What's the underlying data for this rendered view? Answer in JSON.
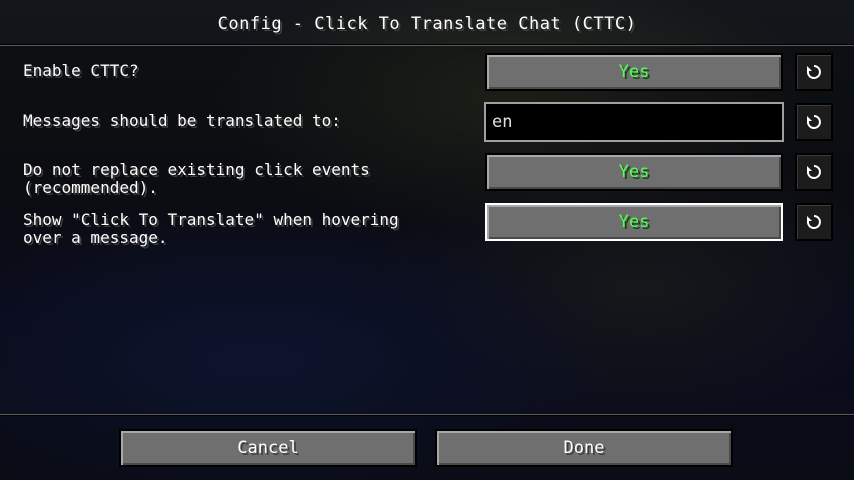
{
  "screen": {
    "title": "Config - Click To Translate Chat (CTTC)"
  },
  "options": [
    {
      "label": "Enable CTTC?",
      "control": "toggle",
      "value": "Yes"
    },
    {
      "label": "Messages should be translated to:",
      "control": "text",
      "value": "en"
    },
    {
      "label": "Do not replace existing click events\n(recommended).",
      "control": "toggle",
      "value": "Yes"
    },
    {
      "label": "Show \"Click To Translate\" when hovering\nover a message.",
      "control": "toggle",
      "value": "Yes"
    }
  ],
  "icons": {
    "reset": "reset-icon"
  },
  "footer": {
    "cancel_label": "Cancel",
    "done_label": "Done"
  },
  "colors": {
    "value_on": "#55ff55",
    "button_face": "#6f6f6f"
  }
}
